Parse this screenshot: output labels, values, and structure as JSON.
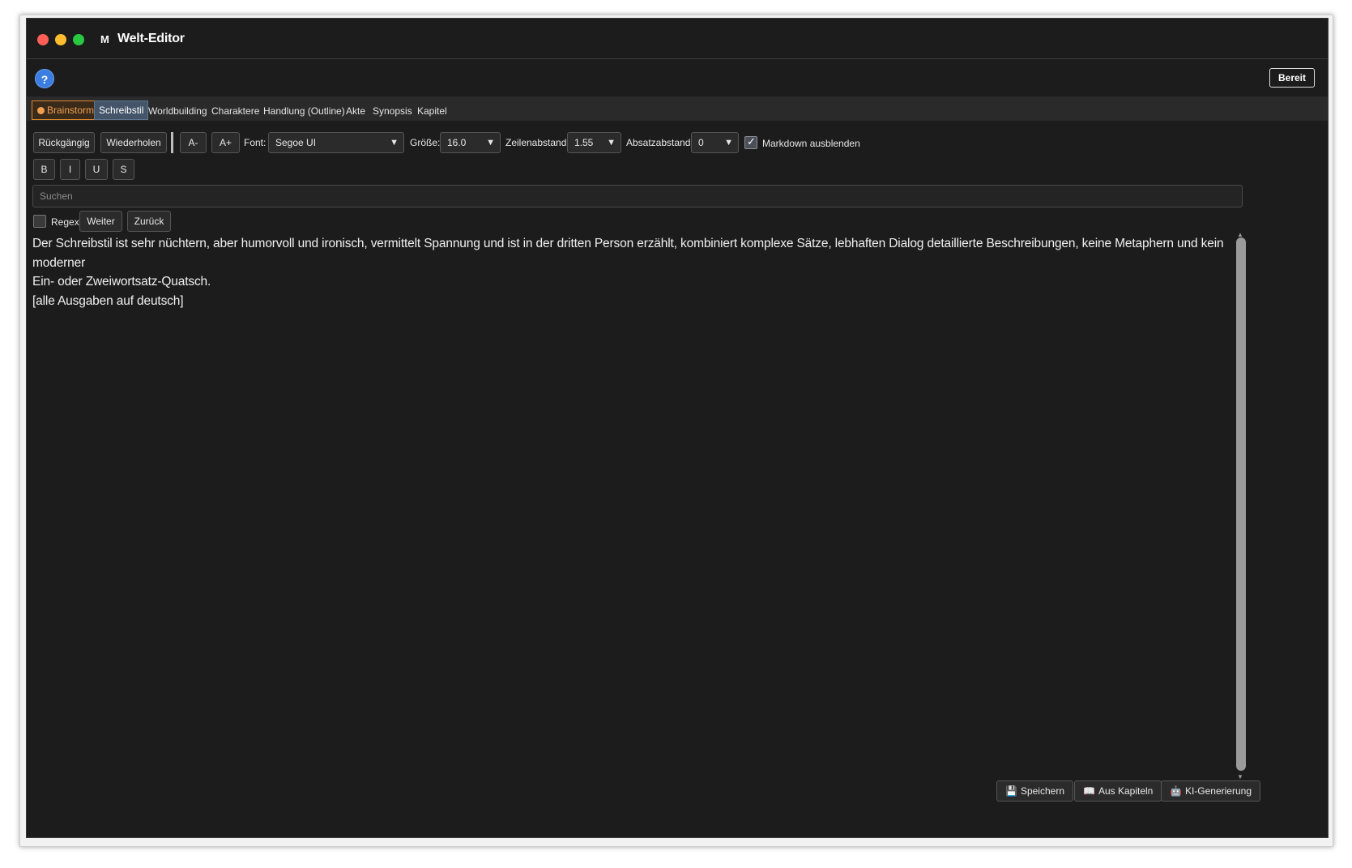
{
  "window": {
    "app_icon": "M",
    "title": "Welt-Editor"
  },
  "toolbar_top": {
    "help_label": "?",
    "status": "Bereit"
  },
  "tabs": [
    {
      "label": "Brainstorm"
    },
    {
      "label": "Schreibstil"
    },
    {
      "label": "Worldbuilding"
    },
    {
      "label": "Charaktere"
    },
    {
      "label": "Handlung (Outline)"
    },
    {
      "label": "Akte"
    },
    {
      "label": "Synopsis"
    },
    {
      "label": "Kapitel"
    }
  ],
  "format_bar": {
    "undo": "Rückgängig",
    "redo": "Wiederholen",
    "font_smaller": "A-",
    "font_larger": "A+",
    "font_label": "Font:",
    "font_value": "Segoe UI",
    "size_label": "Größe:",
    "size_value": "16.0",
    "line_spacing_label": "Zeilenabstand:",
    "line_spacing_value": "1.55",
    "para_spacing_label": "Absatzabstand:",
    "para_spacing_value": "0",
    "hide_markdown_label": "Markdown ausblenden",
    "hide_markdown_checked": true,
    "arrow": "▼"
  },
  "style_buttons": {
    "bold": "B",
    "italic": "I",
    "underline": "U",
    "strike": "S"
  },
  "search": {
    "placeholder": "Suchen",
    "regex_label": "Regex",
    "regex_checked": false,
    "next": "Weiter",
    "prev": "Zurück"
  },
  "editor": {
    "lines": [
      "Der Schreibstil ist sehr nüchtern, aber humorvoll und ironisch, vermittelt Spannung und ist in der dritten Person erzählt, kombiniert komplexe Sätze, lebhaften Dialog detaillierte Beschreibungen, keine Metaphern und kein moderner",
      "Ein- oder Zweiwortsatz-Quatsch.",
      "[alle Ausgaben auf deutsch]"
    ]
  },
  "bottom_buttons": {
    "save": {
      "icon": "💾",
      "label": "Speichern"
    },
    "from_chapters": {
      "icon": "📖",
      "label": "Aus Kapiteln"
    },
    "ai_generation": {
      "icon": "🤖",
      "label": "KI-Generierung"
    }
  },
  "colors": {
    "accent_orange": "#e08a2a",
    "active_tab": "#44556a",
    "help_blue": "#3b7de0",
    "background": "#1c1c1c"
  }
}
